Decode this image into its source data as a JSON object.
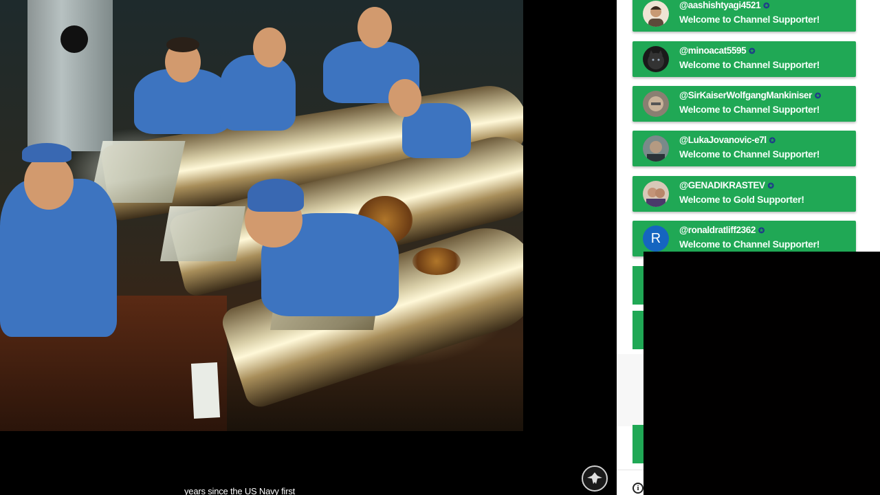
{
  "video": {
    "caption": "years since the US Navy first"
  },
  "chat": {
    "messages": [
      {
        "username": "@aashishtyagi4521",
        "text": "Welcome to Channel Supporter!",
        "avatar": "photo-avatar",
        "avatar_color": "#f0e6d8"
      },
      {
        "username": "@minoacat5595",
        "text": "Welcome to Channel Supporter!",
        "avatar": "photo-avatar",
        "avatar_color": "#1a1a1a"
      },
      {
        "username": "@SirKaiserWolfgangMankiniser",
        "text": "Welcome to Channel Supporter!",
        "avatar": "photo-avatar",
        "avatar_color": "#8a7f72"
      },
      {
        "username": "@LukaJovanovic-e7l",
        "text": "Welcome to Channel Supporter!",
        "avatar": "photo-avatar",
        "avatar_color": "#55656a"
      },
      {
        "username": "@GENADIKRASTEV",
        "text": "Welcome to Gold Supporter!",
        "avatar": "photo-avatar",
        "avatar_color": "#b9a08a"
      },
      {
        "username": "@ronaldratliff2362",
        "text": "Welcome to Channel Supporter!",
        "avatar": "letter-avatar",
        "avatar_letter": "R",
        "avatar_color": "#1565c0"
      }
    ],
    "badge_icon": "member-badge-icon",
    "message_color": "#20a855"
  }
}
